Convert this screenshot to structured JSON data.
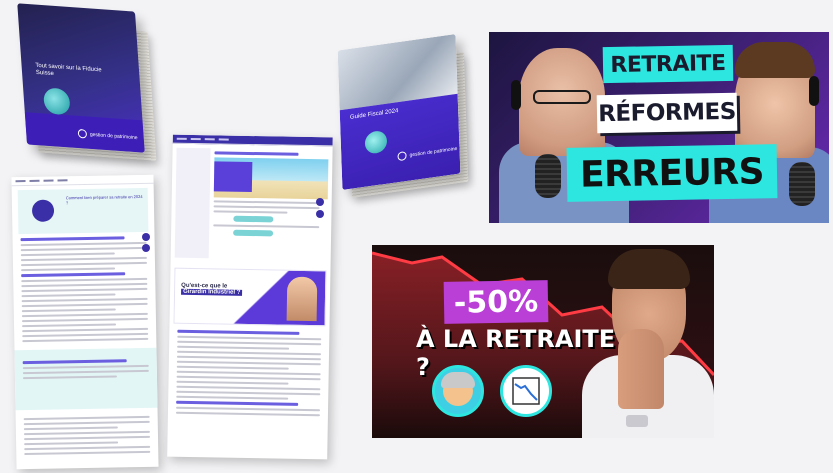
{
  "book_left": {
    "title": "Tout savoir sur la Fiducie Suisse",
    "brand": "gestion de patrimoine"
  },
  "book_right": {
    "title": "Guide Fiscal 2024",
    "brand": "gestion de patrimoine"
  },
  "doc_left": {
    "hero_title": "Comment bien préparer sa retraite en 2024 ?",
    "section_title": "Les meilleures astuces pour l'épargne retraite"
  },
  "doc_right": {
    "hero_title": "Comment investir dans le Girardin Industriel en 2024 ?",
    "promo_question": "Qu'est-ce que le",
    "promo_highlight": "Girardin Industriel ?"
  },
  "thumbnail_podcast": {
    "tag1": "RETRAITE",
    "tag2": "RÉFORMES",
    "tag3": "ERREURS"
  },
  "thumbnail_pension": {
    "badge": "-50%",
    "line2": "À LA RETRAITE ?",
    "icon1": "grandma-icon",
    "icon2": "declining-chart-icon"
  },
  "colors": {
    "brand_purple": "#3a2fa6",
    "accent_cyan": "#2ee6e0",
    "badge_purple": "#b93fd6",
    "chart_red": "#e0303a"
  }
}
